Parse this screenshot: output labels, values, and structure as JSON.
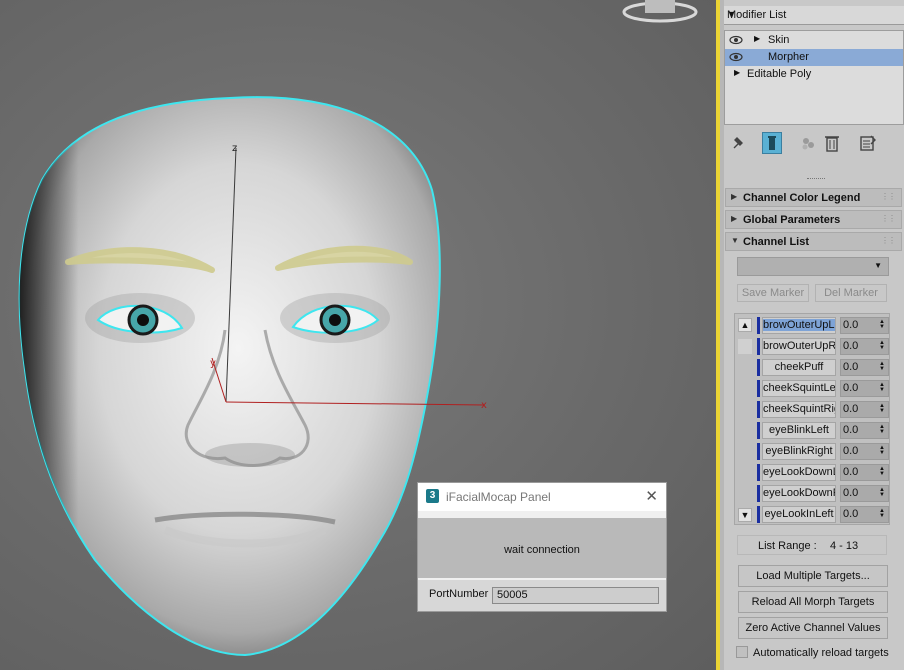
{
  "modifier_panel": {
    "dropdown_label": "Modifier List",
    "stack": [
      {
        "label": "Skin",
        "has_eye": true,
        "expandable": true,
        "selected": false
      },
      {
        "label": "Morpher",
        "has_eye": true,
        "expandable": false,
        "selected": true
      },
      {
        "label": "Editable Poly",
        "has_eye": false,
        "expandable": true,
        "selected": false
      }
    ],
    "toolbar_icons": [
      "pin-icon",
      "show-end-result-icon",
      "make-unique-icon",
      "remove-modifier-icon",
      "configure-modifier-sets-icon"
    ]
  },
  "rollouts": {
    "channel_color_legend": "Channel Color Legend",
    "global_parameters": "Global Parameters",
    "channel_list": "Channel List"
  },
  "channel_list": {
    "marker_dropdown_value": "",
    "save_marker": "Save Marker",
    "del_marker": "Del Marker",
    "channels": [
      {
        "name": "browOuterUpLeft",
        "value": "0.0"
      },
      {
        "name": "browOuterUpRight",
        "value": "0.0"
      },
      {
        "name": "cheekPuff",
        "value": "0.0"
      },
      {
        "name": "cheekSquintLeft",
        "value": "0.0"
      },
      {
        "name": "cheekSquintRight",
        "value": "0.0"
      },
      {
        "name": "eyeBlinkLeft",
        "value": "0.0"
      },
      {
        "name": "eyeBlinkRight",
        "value": "0.0"
      },
      {
        "name": "eyeLookDownLeft",
        "value": "0.0"
      },
      {
        "name": "eyeLookDownRight",
        "value": "0.0"
      },
      {
        "name": "eyeLookInLeft",
        "value": "0.0"
      }
    ],
    "range_label": "List Range :",
    "range_value": "4 - 13",
    "load_multiple": "Load Multiple Targets...",
    "reload_all": "Reload All Morph Targets",
    "zero_active": "Zero Active Channel Values",
    "auto_reload": "Automatically reload targets",
    "auto_reload_checked": false
  },
  "viewport": {
    "axis_labels": {
      "z": "z",
      "y": "y",
      "x": "x"
    }
  },
  "dialog": {
    "title": "iFacialMocap Panel",
    "app_badge": "3",
    "status": "wait connection",
    "port_label": "PortNumber",
    "port_value": "50005",
    "close_glyph": "✕"
  },
  "colors": {
    "selection_outline": "#3ee6ef",
    "active_modifier": "#8aaad6",
    "command_panel_border": "#ebd434",
    "channel_bar": "#1a2ea0"
  }
}
